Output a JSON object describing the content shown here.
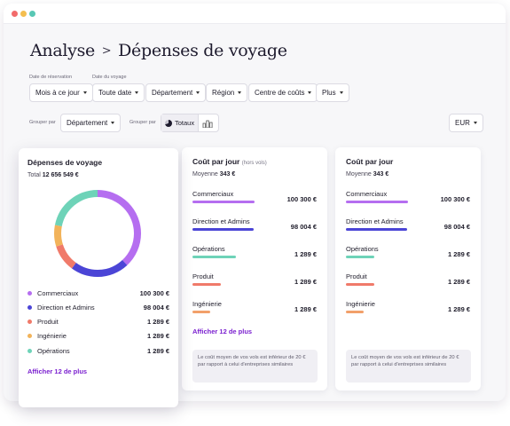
{
  "header": {
    "section": "Analyse",
    "separator": ">",
    "page": "Dépenses de voyage"
  },
  "filters": {
    "booking_date_label": "Date de réservation",
    "travel_date_label": "Date du voyage",
    "booking_date": "Mois à ce jour",
    "travel_date": "Toute date",
    "department": "Département",
    "region": "Région",
    "cost_center": "Centre de coûts",
    "more": "Plus"
  },
  "grouping": {
    "label1": "Grouper par",
    "value1": "Département",
    "label2": "Grouper par",
    "totals": "Totaux",
    "currency": "EUR"
  },
  "expenses_card": {
    "title": "Dépenses de voyage",
    "total_label": "Total",
    "total_value": "12 656 549 €",
    "show_more": "Afficher 12 de plus",
    "items": [
      {
        "name": "Commerciaux",
        "value": "100 300 €",
        "color": "#b56ef0",
        "share": 0.38
      },
      {
        "name": "Direction et Admins",
        "value": "98 004 €",
        "color": "#4b45d6",
        "share": 0.22
      },
      {
        "name": "Produit",
        "value": "1 289 €",
        "color": "#f07a6a",
        "share": 0.1
      },
      {
        "name": "Ingénierie",
        "value": "1 289 €",
        "color": "#f2b35a",
        "share": 0.08
      },
      {
        "name": "Opérations",
        "value": "1 289 €",
        "color": "#6ed3b8",
        "share": 0.22
      }
    ]
  },
  "cost_card_flights": {
    "title": "Coût par jour",
    "subtitle": "(hors vols)",
    "avg_label": "Moyenne",
    "avg_value": "343 €",
    "show_more": "Afficher 12 de plus",
    "note": "Le coût moyen de vos vols est inférieur de 20 € par rapport à celui d'entreprises similaires",
    "rows": [
      {
        "name": "Commerciaux",
        "value": "100 300 €",
        "color": "#b56ef0",
        "fill": 1.0
      },
      {
        "name": "Direction et Admins",
        "value": "98 004 €",
        "color": "#4b45d6",
        "fill": 0.98
      },
      {
        "name": "Opérations",
        "value": "1 289 €",
        "color": "#6ed3b8",
        "fill": 0.7
      },
      {
        "name": "Produit",
        "value": "1 289 €",
        "color": "#f07a6a",
        "fill": 0.45
      },
      {
        "name": "Ingénierie",
        "value": "1 289 €",
        "color": "#f2a06a",
        "fill": 0.28
      }
    ]
  },
  "cost_card": {
    "title": "Coût par jour",
    "avg_label": "Moyenne",
    "avg_value": "343 €",
    "note": "Le coût moyen de vos vols est inférieur de 20 € par rapport à celui d'entreprises similaires",
    "rows": [
      {
        "name": "Commerciaux",
        "value": "100 300 €",
        "color": "#b56ef0",
        "fill": 1.0
      },
      {
        "name": "Direction et Admins",
        "value": "98 004 €",
        "color": "#4b45d6",
        "fill": 0.98
      },
      {
        "name": "Opérations",
        "value": "1 289 €",
        "color": "#6ed3b8",
        "fill": 0.45
      },
      {
        "name": "Produit",
        "value": "1 289 €",
        "color": "#f07a6a",
        "fill": 0.45
      },
      {
        "name": "Ingénierie",
        "value": "1 289 €",
        "color": "#f2a06a",
        "fill": 0.28
      }
    ]
  }
}
